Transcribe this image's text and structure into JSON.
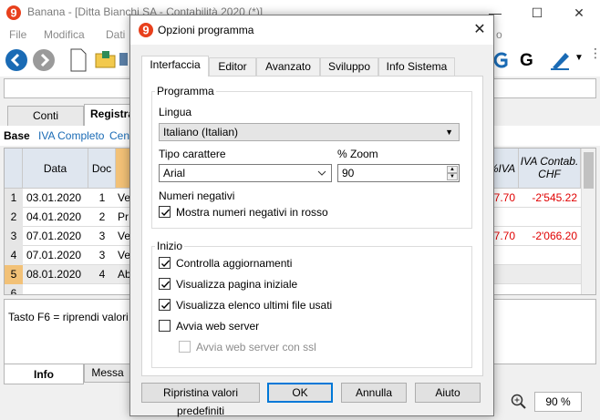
{
  "main_window": {
    "title": "Banana - [Ditta Bianchi SA - Contabilità 2020 (*)]",
    "menu": [
      "File",
      "Modifica",
      "Dati"
    ],
    "menu_partial": "o",
    "toolbar_letter": "G",
    "tabs": [
      "Conti",
      "Registra"
    ],
    "views": [
      "Base",
      "IVA Completo",
      "Centr"
    ],
    "columns": [
      "Data",
      "Doc"
    ],
    "right_columns": [
      "%IVA",
      "IVA Contab.",
      "CHF"
    ],
    "rows": [
      {
        "num": "1",
        "date": "03.01.2020",
        "doc": "1",
        "desc": "Ve",
        "iva_partial": "7.70",
        "amount": "-2'545.22"
      },
      {
        "num": "2",
        "date": "04.01.2020",
        "doc": "2",
        "desc": "Pr",
        "iva_partial": "",
        "amount": ""
      },
      {
        "num": "3",
        "date": "07.01.2020",
        "doc": "3",
        "desc": "Ve",
        "iva_partial": "7.70",
        "amount": "-2'066.20"
      },
      {
        "num": "4",
        "date": "07.01.2020",
        "doc": "3",
        "desc": "Ve",
        "iva_partial": "",
        "amount": ""
      },
      {
        "num": "5",
        "date": "08.01.2020",
        "doc": "4",
        "desc": "Ab",
        "iva_partial": "",
        "amount": ""
      },
      {
        "num": "6",
        "date": "",
        "doc": "",
        "desc": "",
        "iva_partial": "",
        "amount": ""
      }
    ],
    "info_text": "Tasto F6 = riprendi valori rig",
    "bottom_tabs": [
      "Info",
      "Messa"
    ],
    "zoom": "90 %",
    "accent_color": "#1a6bb5",
    "negative_color": "#e00000"
  },
  "dialog": {
    "title": "Opzioni programma",
    "tabs": [
      "Interfaccia",
      "Editor",
      "Avanzato",
      "Sviluppo",
      "Info Sistema"
    ],
    "active_tab": "Interfaccia",
    "programma": {
      "legend": "Programma",
      "lingua_label": "Lingua",
      "lingua_value": "Italiano (Italian)",
      "font_label": "Tipo carattere",
      "font_value": "Arial",
      "zoom_label": "% Zoom",
      "zoom_value": "90",
      "negativi_label": "Numeri negativi",
      "negativi_check": {
        "label": "Mostra numeri negativi in rosso",
        "checked": true
      }
    },
    "inizio": {
      "legend": "Inizio",
      "checks": [
        {
          "label": "Controlla aggiornamenti",
          "checked": true
        },
        {
          "label": "Visualizza pagina iniziale",
          "checked": true
        },
        {
          "label": "Visualizza elenco ultimi file usati",
          "checked": true
        },
        {
          "label": "Avvia web server",
          "checked": false
        },
        {
          "label": "Avvia web server con ssl",
          "checked": false,
          "disabled": true
        }
      ]
    },
    "buttons": {
      "reset": "Ripristina valori predefiniti",
      "ok": "OK",
      "cancel": "Annulla",
      "help": "Aiuto"
    }
  }
}
